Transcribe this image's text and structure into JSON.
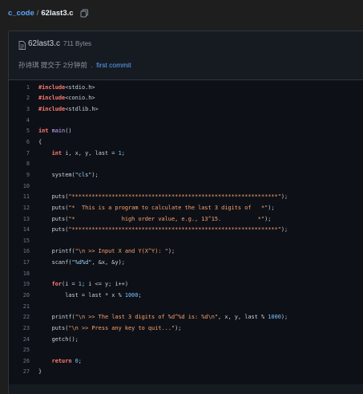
{
  "breadcrumb": {
    "repo": "c_code",
    "separator": "/",
    "file": "62last3.c"
  },
  "file": {
    "name": "62last3.c",
    "size": "711 Bytes"
  },
  "commit": {
    "author": "孙诗琪",
    "time": "提交于 2分钟前",
    "dot": ".",
    "message": "first commit"
  },
  "code_lines": [
    {
      "n": "1",
      "tokens": [
        {
          "t": "#include",
          "c": "dir"
        },
        {
          "t": "<stdio.h>",
          "c": "plain"
        }
      ]
    },
    {
      "n": "2",
      "tokens": [
        {
          "t": "#include",
          "c": "dir"
        },
        {
          "t": "<conio.h>",
          "c": "plain"
        }
      ]
    },
    {
      "n": "3",
      "tokens": [
        {
          "t": "#include",
          "c": "dir"
        },
        {
          "t": "<stdlib.h>",
          "c": "plain"
        }
      ]
    },
    {
      "n": "4",
      "tokens": []
    },
    {
      "n": "5",
      "tokens": [
        {
          "t": "int ",
          "c": "kw"
        },
        {
          "t": "main",
          "c": "fn"
        },
        {
          "t": "()",
          "c": "plain"
        }
      ]
    },
    {
      "n": "6",
      "tokens": [
        {
          "t": "{",
          "c": "plain"
        }
      ]
    },
    {
      "n": "7",
      "tokens": [
        {
          "t": "    int ",
          "c": "kw"
        },
        {
          "t": "i, x, y, last = ",
          "c": "plain"
        },
        {
          "t": "1",
          "c": "num"
        },
        {
          "t": ";",
          "c": "plain"
        }
      ]
    },
    {
      "n": "8",
      "tokens": []
    },
    {
      "n": "9",
      "tokens": [
        {
          "t": "    system(",
          "c": "plain"
        },
        {
          "t": "\"cls\"",
          "c": "str"
        },
        {
          "t": ");",
          "c": "plain"
        }
      ]
    },
    {
      "n": "10",
      "tokens": []
    },
    {
      "n": "11",
      "tokens": [
        {
          "t": "    puts(",
          "c": "plain"
        },
        {
          "t": "\"**************************************************************\"",
          "c": "str2"
        },
        {
          "t": ");",
          "c": "plain"
        }
      ]
    },
    {
      "n": "12",
      "tokens": [
        {
          "t": "    puts(",
          "c": "plain"
        },
        {
          "t": "\"*  This is a program to calculate the last 3 digits of   *\"",
          "c": "str2"
        },
        {
          "t": ");",
          "c": "plain"
        }
      ]
    },
    {
      "n": "13",
      "tokens": [
        {
          "t": "    puts(",
          "c": "plain"
        },
        {
          "t": "\"*              high order value, e.g., 13^15.           *\"",
          "c": "str2"
        },
        {
          "t": ");",
          "c": "plain"
        }
      ]
    },
    {
      "n": "14",
      "tokens": [
        {
          "t": "    puts(",
          "c": "plain"
        },
        {
          "t": "\"**************************************************************\"",
          "c": "str2"
        },
        {
          "t": ");",
          "c": "plain"
        }
      ]
    },
    {
      "n": "15",
      "tokens": []
    },
    {
      "n": "16",
      "tokens": [
        {
          "t": "    printf(",
          "c": "plain"
        },
        {
          "t": "\"\\n >> Input X and Y(X^Y): \"",
          "c": "str2"
        },
        {
          "t": ");",
          "c": "plain"
        }
      ]
    },
    {
      "n": "17",
      "tokens": [
        {
          "t": "    scanf(",
          "c": "plain"
        },
        {
          "t": "\"%d%d\"",
          "c": "str"
        },
        {
          "t": ", &x, &y);",
          "c": "plain"
        }
      ]
    },
    {
      "n": "18",
      "tokens": []
    },
    {
      "n": "19",
      "tokens": [
        {
          "t": "    for",
          "c": "kw"
        },
        {
          "t": "(i = ",
          "c": "plain"
        },
        {
          "t": "1",
          "c": "num"
        },
        {
          "t": "; i <= y; i++)",
          "c": "plain"
        }
      ]
    },
    {
      "n": "20",
      "tokens": [
        {
          "t": "        last = last * x % ",
          "c": "plain"
        },
        {
          "t": "1000",
          "c": "num"
        },
        {
          "t": ";",
          "c": "plain"
        }
      ]
    },
    {
      "n": "21",
      "tokens": []
    },
    {
      "n": "22",
      "tokens": [
        {
          "t": "    printf(",
          "c": "plain"
        },
        {
          "t": "\"\\n >> The last 3 digits of %d^%d is: %d\\n\"",
          "c": "str2"
        },
        {
          "t": ", x, y, last % ",
          "c": "plain"
        },
        {
          "t": "1000",
          "c": "num"
        },
        {
          "t": ");",
          "c": "plain"
        }
      ]
    },
    {
      "n": "23",
      "tokens": [
        {
          "t": "    puts(",
          "c": "plain"
        },
        {
          "t": "\"\\n >> Press any key to quit...\"",
          "c": "str2"
        },
        {
          "t": ");",
          "c": "plain"
        }
      ]
    },
    {
      "n": "24",
      "tokens": [
        {
          "t": "    getch();",
          "c": "plain"
        }
      ]
    },
    {
      "n": "25",
      "tokens": []
    },
    {
      "n": "26",
      "tokens": [
        {
          "t": "    return ",
          "c": "kw"
        },
        {
          "t": "0",
          "c": "num"
        },
        {
          "t": ";",
          "c": "plain"
        }
      ]
    },
    {
      "n": "27",
      "tokens": [
        {
          "t": "}",
          "c": "plain"
        }
      ]
    }
  ],
  "colors": {
    "background": "#1e1e1e",
    "link": "#58a6ff",
    "keyword": "#ff7b72",
    "function": "#d2a8ff",
    "string": "#a5d6ff",
    "string_alt": "#ff9f6b",
    "number": "#79c0ff"
  },
  "icons": {
    "copy": "copy-icon",
    "file": "file-icon"
  }
}
